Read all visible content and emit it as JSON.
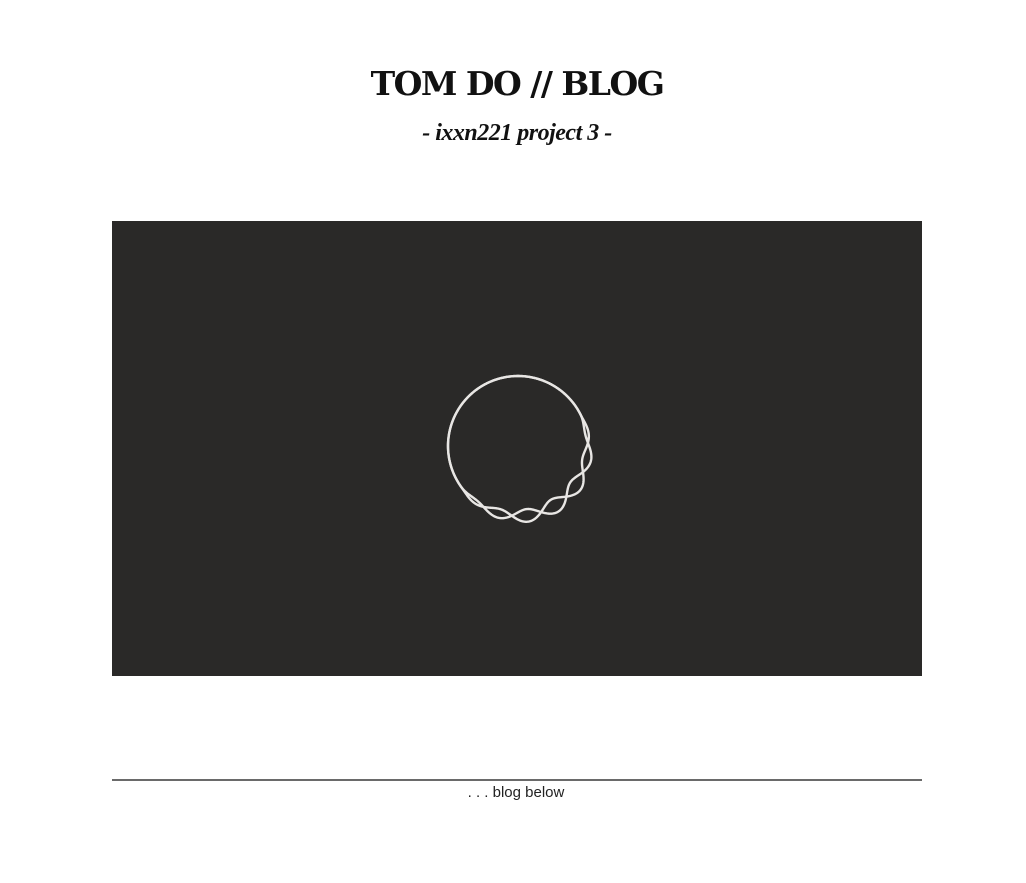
{
  "header": {
    "title": "TOM DO // BLOG",
    "subtitle": "- ixxn221 project 3 -"
  },
  "canvas": {
    "background_color": "#2a2928",
    "stroke_color": "#e8e6e4",
    "graphic": "wavy-ring-icon"
  },
  "footer": {
    "blog_below_text": ". . . blog below"
  }
}
